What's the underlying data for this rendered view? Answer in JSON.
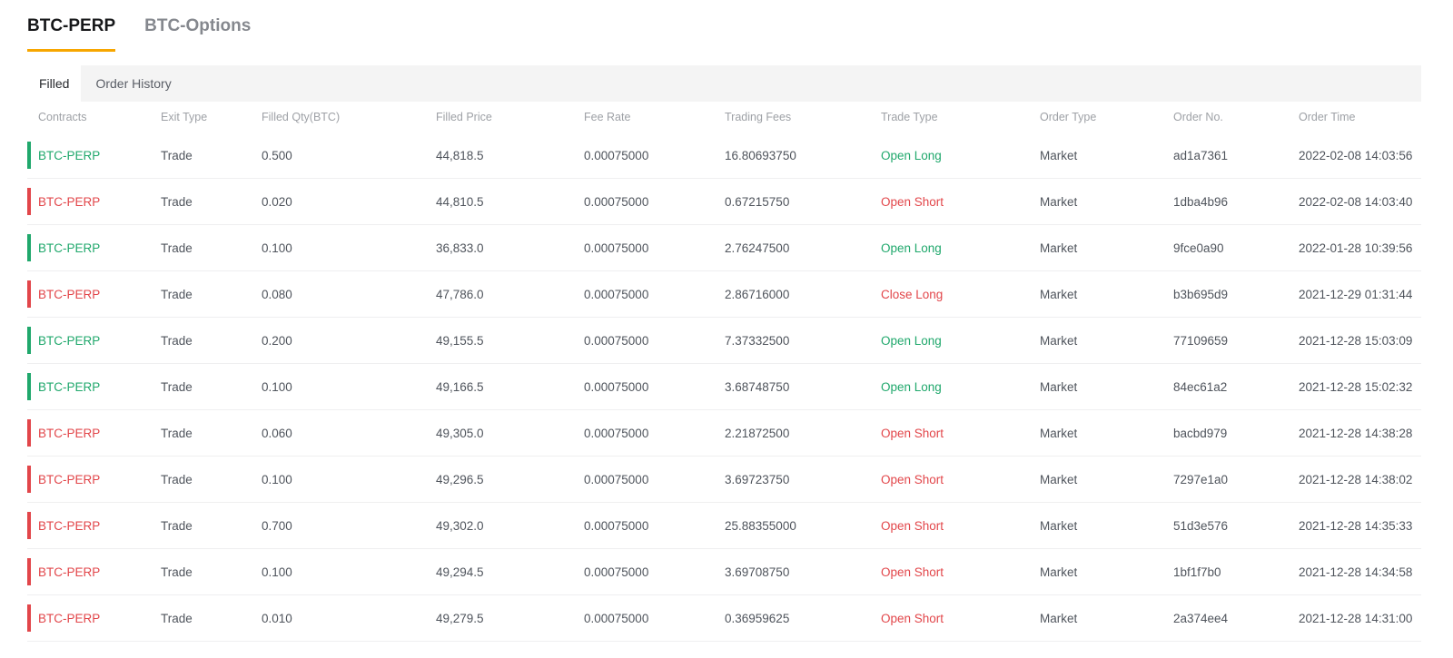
{
  "colors": {
    "accent_orange": "#f7a600",
    "green": "#20a86c",
    "red": "#e2464a"
  },
  "contract_tabs": [
    {
      "label": "BTC-PERP",
      "active": true
    },
    {
      "label": "BTC-Options",
      "active": false
    }
  ],
  "sub_tabs": [
    {
      "label": "Filled",
      "active": true
    },
    {
      "label": "Order History",
      "active": false
    }
  ],
  "table": {
    "columns": [
      "Contracts",
      "Exit Type",
      "Filled Qty(BTC)",
      "Filled Price",
      "Fee Rate",
      "Trading Fees",
      "Trade Type",
      "Order Type",
      "Order No.",
      "Order Time"
    ],
    "rows": [
      {
        "contract": "BTC-PERP",
        "side": "long",
        "exit_type": "Trade",
        "filled_qty": "0.500",
        "filled_price": "44,818.5",
        "fee_rate": "0.00075000",
        "trading_fees": "16.80693750",
        "trade_type": "Open Long",
        "trade_type_color": "green",
        "order_type": "Market",
        "order_no": "ad1a7361",
        "order_time": "2022-02-08 14:03:56"
      },
      {
        "contract": "BTC-PERP",
        "side": "short",
        "exit_type": "Trade",
        "filled_qty": "0.020",
        "filled_price": "44,810.5",
        "fee_rate": "0.00075000",
        "trading_fees": "0.67215750",
        "trade_type": "Open Short",
        "trade_type_color": "red",
        "order_type": "Market",
        "order_no": "1dba4b96",
        "order_time": "2022-02-08 14:03:40"
      },
      {
        "contract": "BTC-PERP",
        "side": "long",
        "exit_type": "Trade",
        "filled_qty": "0.100",
        "filled_price": "36,833.0",
        "fee_rate": "0.00075000",
        "trading_fees": "2.76247500",
        "trade_type": "Open Long",
        "trade_type_color": "green",
        "order_type": "Market",
        "order_no": "9fce0a90",
        "order_time": "2022-01-28 10:39:56"
      },
      {
        "contract": "BTC-PERP",
        "side": "short",
        "exit_type": "Trade",
        "filled_qty": "0.080",
        "filled_price": "47,786.0",
        "fee_rate": "0.00075000",
        "trading_fees": "2.86716000",
        "trade_type": "Close Long",
        "trade_type_color": "red",
        "order_type": "Market",
        "order_no": "b3b695d9",
        "order_time": "2021-12-29 01:31:44"
      },
      {
        "contract": "BTC-PERP",
        "side": "long",
        "exit_type": "Trade",
        "filled_qty": "0.200",
        "filled_price": "49,155.5",
        "fee_rate": "0.00075000",
        "trading_fees": "7.37332500",
        "trade_type": "Open Long",
        "trade_type_color": "green",
        "order_type": "Market",
        "order_no": "77109659",
        "order_time": "2021-12-28 15:03:09"
      },
      {
        "contract": "BTC-PERP",
        "side": "long",
        "exit_type": "Trade",
        "filled_qty": "0.100",
        "filled_price": "49,166.5",
        "fee_rate": "0.00075000",
        "trading_fees": "3.68748750",
        "trade_type": "Open Long",
        "trade_type_color": "green",
        "order_type": "Market",
        "order_no": "84ec61a2",
        "order_time": "2021-12-28 15:02:32"
      },
      {
        "contract": "BTC-PERP",
        "side": "short",
        "exit_type": "Trade",
        "filled_qty": "0.060",
        "filled_price": "49,305.0",
        "fee_rate": "0.00075000",
        "trading_fees": "2.21872500",
        "trade_type": "Open Short",
        "trade_type_color": "red",
        "order_type": "Market",
        "order_no": "bacbd979",
        "order_time": "2021-12-28 14:38:28"
      },
      {
        "contract": "BTC-PERP",
        "side": "short",
        "exit_type": "Trade",
        "filled_qty": "0.100",
        "filled_price": "49,296.5",
        "fee_rate": "0.00075000",
        "trading_fees": "3.69723750",
        "trade_type": "Open Short",
        "trade_type_color": "red",
        "order_type": "Market",
        "order_no": "7297e1a0",
        "order_time": "2021-12-28 14:38:02"
      },
      {
        "contract": "BTC-PERP",
        "side": "short",
        "exit_type": "Trade",
        "filled_qty": "0.700",
        "filled_price": "49,302.0",
        "fee_rate": "0.00075000",
        "trading_fees": "25.88355000",
        "trade_type": "Open Short",
        "trade_type_color": "red",
        "order_type": "Market",
        "order_no": "51d3e576",
        "order_time": "2021-12-28 14:35:33"
      },
      {
        "contract": "BTC-PERP",
        "side": "short",
        "exit_type": "Trade",
        "filled_qty": "0.100",
        "filled_price": "49,294.5",
        "fee_rate": "0.00075000",
        "trading_fees": "3.69708750",
        "trade_type": "Open Short",
        "trade_type_color": "red",
        "order_type": "Market",
        "order_no": "1bf1f7b0",
        "order_time": "2021-12-28 14:34:58"
      },
      {
        "contract": "BTC-PERP",
        "side": "short",
        "exit_type": "Trade",
        "filled_qty": "0.010",
        "filled_price": "49,279.5",
        "fee_rate": "0.00075000",
        "trading_fees": "0.36959625",
        "trade_type": "Open Short",
        "trade_type_color": "red",
        "order_type": "Market",
        "order_no": "2a374ee4",
        "order_time": "2021-12-28 14:31:00"
      }
    ]
  }
}
